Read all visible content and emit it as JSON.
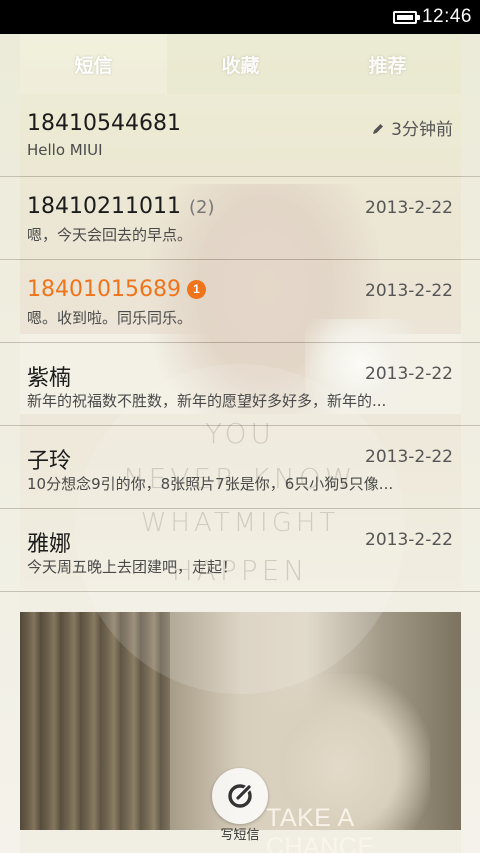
{
  "status_bar": {
    "time": "12:46"
  },
  "tabs": [
    {
      "label": "短信",
      "active": true
    },
    {
      "label": "收藏",
      "active": false
    },
    {
      "label": "推荐",
      "active": false
    }
  ],
  "conversations": [
    {
      "name": "18410544681",
      "count": "",
      "badge": "",
      "date": "3分钟前",
      "snippet": "Hello MIUI",
      "unread": false,
      "draft_icon": "pencil-icon"
    },
    {
      "name": "18410211011",
      "count": "(2)",
      "badge": "",
      "date": "2013-2-22",
      "snippet": "嗯，今天会回去的早点。",
      "unread": false
    },
    {
      "name": "18401015689",
      "count": "",
      "badge": "1",
      "date": "2013-2-22",
      "snippet": "嗯。收到啦。同乐同乐。",
      "unread": true
    },
    {
      "name": "紫楠",
      "count": "",
      "badge": "",
      "date": "2013-2-22",
      "snippet": "新年的祝福数不胜数，新年的愿望好多好多，新年的...",
      "unread": false
    },
    {
      "name": "子玲",
      "count": "",
      "badge": "",
      "date": "2013-2-22",
      "snippet": "10分想念9引的你，8张照片7张是你，6只小狗5只像...",
      "unread": false
    },
    {
      "name": "雅娜",
      "count": "",
      "badge": "",
      "date": "2013-2-22",
      "snippet": "今天周五晚上去团建吧，走起！",
      "unread": false
    }
  ],
  "wallpaper": {
    "line1": "YOU",
    "line2": "NEVER KNOW",
    "line3": "WHATMIGHT",
    "line4": "HAPPEN",
    "take": "TAKE A",
    "chance": "CHANCE"
  },
  "compose": {
    "label": "写短信",
    "icon": "compose-icon"
  },
  "colors": {
    "unread": "#f0741c",
    "status_bar": "#000000"
  }
}
